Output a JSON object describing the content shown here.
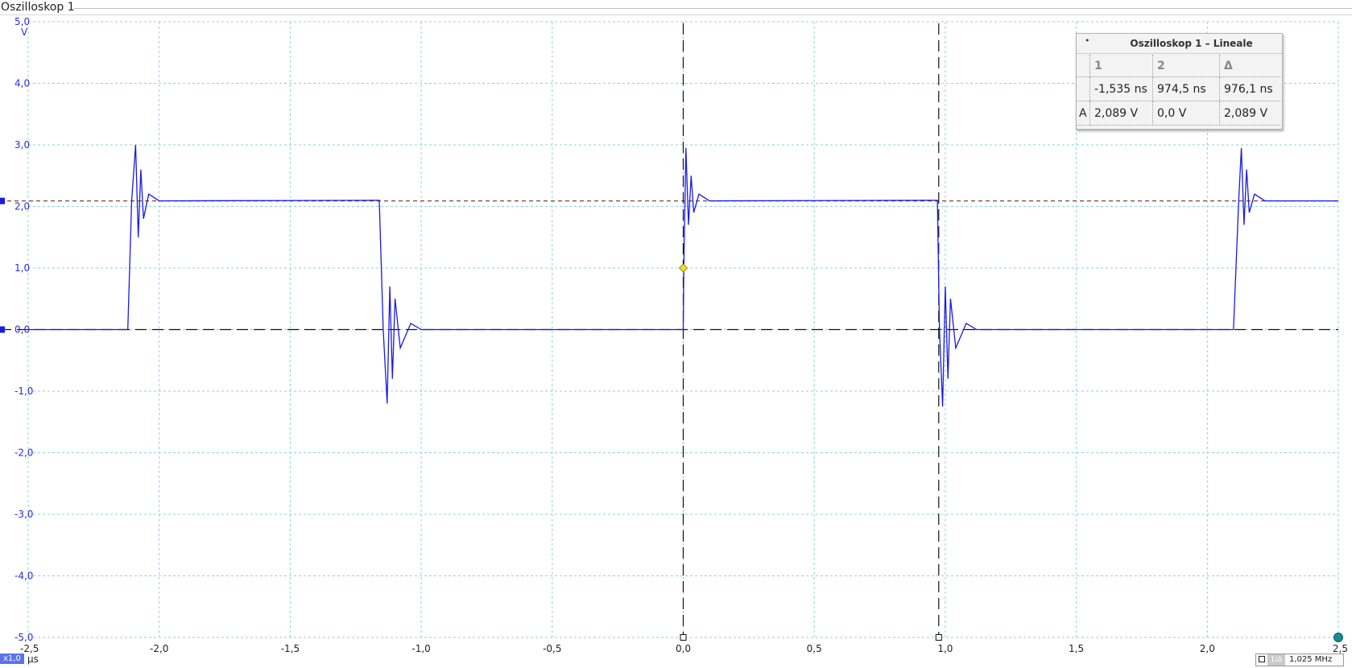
{
  "window": {
    "title": "Oszilloskop 1"
  },
  "scope": {
    "y_axis": {
      "min": -5.0,
      "max": 5.0,
      "unit": "V",
      "ticks": [
        "5,0",
        "4,0",
        "3,0",
        "2,0",
        "1,0",
        "0,0",
        "-1,0",
        "-2,0",
        "-3,0",
        "-4,0",
        "-5,0"
      ],
      "tick_values": [
        5,
        4,
        3,
        2,
        1,
        0,
        -1,
        -2,
        -3,
        -4,
        -5
      ]
    },
    "x_axis": {
      "min": -2.5,
      "max": 2.5,
      "unit": "µs",
      "ticks": [
        "-2,5",
        "-2,0",
        "-1,5",
        "-1,0",
        "-0,5",
        "0,0",
        "0,5",
        "1,0",
        "1,5",
        "2,0",
        "2,5"
      ],
      "tick_values": [
        -2.5,
        -2.0,
        -1.5,
        -1.0,
        -0.5,
        0.0,
        0.5,
        1.0,
        1.5,
        2.0,
        2.5
      ]
    },
    "grid": true,
    "colors": {
      "trace": "#1a1ae6",
      "grid": "#8fd0dc",
      "ruler": "#111111",
      "cursor_h": "#6b2f2f",
      "trigger": "#f0e020",
      "endpoint": "#1a8a8a"
    },
    "trigger": {
      "time_us": 0.0,
      "level_v": 1.0
    },
    "horizontal_markers_v": [
      2.089,
      0.0
    ]
  },
  "chart_data": {
    "type": "line",
    "xlabel": "µs",
    "ylabel": "V",
    "xlim": [
      -2.5,
      2.5
    ],
    "ylim": [
      -5.0,
      5.0
    ],
    "series": [
      {
        "values_note": "",
        "x": [
          -2.5,
          -2.12,
          -2.105,
          -2.09,
          -2.08,
          -2.07,
          -2.06,
          -2.04,
          -2.0,
          -1.16,
          -1.145,
          -1.13,
          -1.12,
          -1.11,
          -1.1,
          -1.08,
          -1.04,
          -1.0,
          0.0,
          0.002,
          0.01,
          0.02,
          0.03,
          0.04,
          0.06,
          0.1,
          0.97,
          0.978,
          0.99,
          1.0,
          1.01,
          1.02,
          1.04,
          1.08,
          1.12,
          2.1,
          2.12,
          2.13,
          2.14,
          2.15,
          2.16,
          2.18,
          2.22,
          2.5
        ],
        "y": [
          0.0,
          0.0,
          2.09,
          3.0,
          1.5,
          2.6,
          1.8,
          2.2,
          2.09,
          2.1,
          0.0,
          -1.2,
          0.7,
          -0.8,
          0.5,
          -0.3,
          0.1,
          0.0,
          0.0,
          1.0,
          2.95,
          1.7,
          2.5,
          1.9,
          2.2,
          2.09,
          2.1,
          0.0,
          -1.25,
          0.7,
          -0.8,
          0.5,
          -0.3,
          0.1,
          0.0,
          0.0,
          2.09,
          2.95,
          1.7,
          2.6,
          1.9,
          2.2,
          2.09,
          2.09
        ]
      }
    ]
  },
  "rulers": {
    "panel_title": "Oszilloskop 1 – Lineale",
    "panel_dot": "•",
    "vertical_ruler_times_us": [
      0.0,
      0.975
    ],
    "headers": [
      "",
      "1",
      "2",
      "Δ"
    ],
    "rows": [
      [
        "",
        "-1,535 ns",
        "974,5 ns",
        "976,1 ns"
      ],
      [
        "A",
        "2,089 V",
        "0,0 V",
        "2,089 V"
      ]
    ]
  },
  "footer": {
    "zoom": "x1,0",
    "unit_x": "µs",
    "freq_mode": "1/Δ",
    "frequency": "1,025 MHz"
  }
}
